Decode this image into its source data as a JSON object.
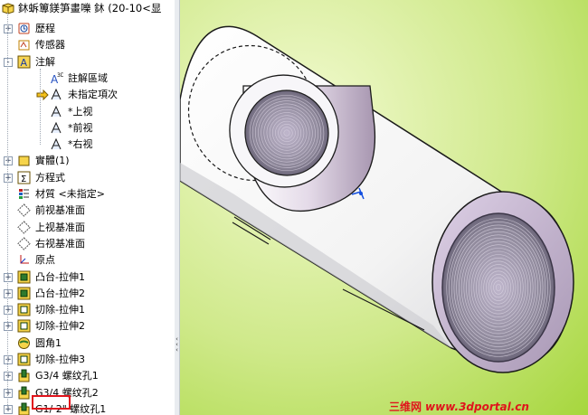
{
  "window": {
    "title": "鈢蚸篿鎂笋畫嚛   鈢 (20-10<显"
  },
  "tree": {
    "items": [
      {
        "id": "history",
        "label": "歷程",
        "icon": "history-icon",
        "expander": "+"
      },
      {
        "id": "sensors",
        "label": "传感器",
        "icon": "sensor-icon",
        "expander": ""
      },
      {
        "id": "annotations",
        "label": "注解",
        "icon": "annotation-icon",
        "expander": "-"
      },
      {
        "id": "ann-area",
        "label": "註解區域",
        "icon": "annotation-area-icon",
        "expander": ""
      },
      {
        "id": "ann-unassigned",
        "label": "未指定項次",
        "icon": "annotation-view-icon",
        "expander": ""
      },
      {
        "id": "ann-top",
        "label": "*上视",
        "icon": "annotation-view-icon",
        "expander": ""
      },
      {
        "id": "ann-front",
        "label": "*前视",
        "icon": "annotation-view-icon",
        "expander": ""
      },
      {
        "id": "ann-right",
        "label": "*右视",
        "icon": "annotation-view-icon",
        "expander": ""
      },
      {
        "id": "solid-bodies",
        "label": "實體(1)",
        "icon": "solid-body-icon",
        "expander": "+"
      },
      {
        "id": "equations",
        "label": "方程式",
        "icon": "equation-icon",
        "expander": "+"
      },
      {
        "id": "material",
        "label": "材質 <未指定>",
        "icon": "material-icon",
        "expander": ""
      },
      {
        "id": "front-plane",
        "label": "前视基准面",
        "icon": "plane-icon",
        "expander": ""
      },
      {
        "id": "top-plane",
        "label": "上视基准面",
        "icon": "plane-icon",
        "expander": ""
      },
      {
        "id": "right-plane",
        "label": "右视基准面",
        "icon": "plane-icon",
        "expander": ""
      },
      {
        "id": "origin",
        "label": "原点",
        "icon": "origin-icon",
        "expander": ""
      },
      {
        "id": "boss-extrude1",
        "label": "凸台-拉伸1",
        "icon": "extrude-icon",
        "expander": "+"
      },
      {
        "id": "boss-extrude2",
        "label": "凸台-拉伸2",
        "icon": "extrude-icon",
        "expander": "+"
      },
      {
        "id": "cut-extrude1",
        "label": "切除-拉伸1",
        "icon": "cut-icon",
        "expander": "+"
      },
      {
        "id": "cut-extrude2",
        "label": "切除-拉伸2",
        "icon": "cut-icon",
        "expander": "+"
      },
      {
        "id": "fillet1",
        "label": "圆角1",
        "icon": "fillet-icon",
        "expander": ""
      },
      {
        "id": "cut-extrude3",
        "label": "切除-拉伸3",
        "icon": "cut-icon",
        "expander": "+"
      },
      {
        "id": "thread1",
        "label": "G3/4 螺纹孔1",
        "icon": "hole-wizard-icon",
        "expander": "+"
      },
      {
        "id": "thread2",
        "label": "G3/4 螺纹孔2",
        "icon": "hole-wizard-icon",
        "expander": "+"
      },
      {
        "id": "thread3",
        "label": "G1/ 2\" 螺纹孔1",
        "icon": "hole-wizard-icon",
        "expander": "+"
      }
    ]
  },
  "watermark": {
    "cn": "三维网",
    "url": "www.3dportal.cn"
  },
  "colors": {
    "viewport_bg_center": "#f0f9c8",
    "viewport_bg_edge": "#a5d63b",
    "highlight": "#e0141c"
  }
}
